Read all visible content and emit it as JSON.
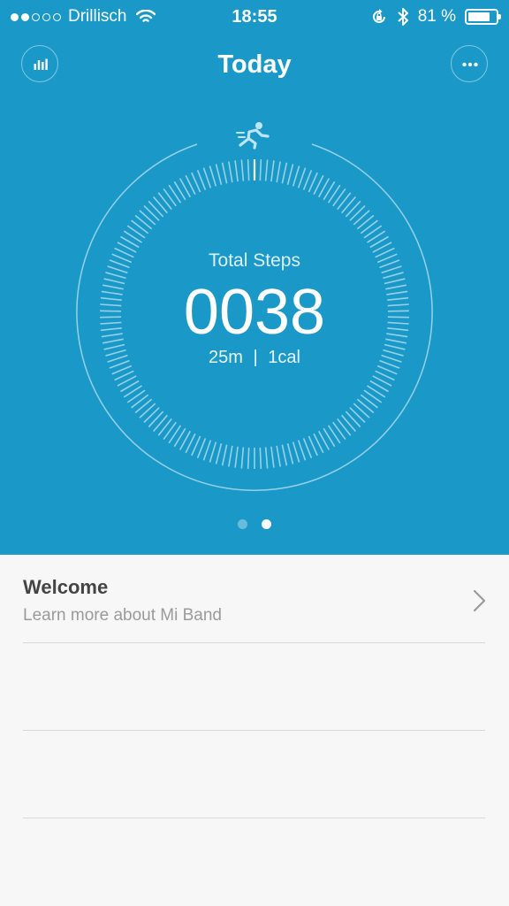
{
  "status_bar": {
    "signal_dots": [
      true,
      true,
      false,
      false,
      false
    ],
    "carrier": "Drillisch",
    "time": "18:55",
    "battery_percent": "81 %",
    "battery_level": 0.81
  },
  "header": {
    "title": "Today",
    "left_icon": "bar-chart-icon",
    "right_icon": "more-icon"
  },
  "activity": {
    "icon": "running-icon",
    "label": "Total Steps",
    "steps": "0038",
    "distance": "25m",
    "separator": "|",
    "calories": "1cal"
  },
  "pager": {
    "pages": 2,
    "active_index": 1
  },
  "cards": [
    {
      "title": "Welcome",
      "subtitle": "Learn more about Mi Band"
    }
  ],
  "colors": {
    "accent": "#1a99c9",
    "background": "#f7f7f7",
    "title_text": "#444444",
    "subtitle_text": "#9a9a9a"
  }
}
